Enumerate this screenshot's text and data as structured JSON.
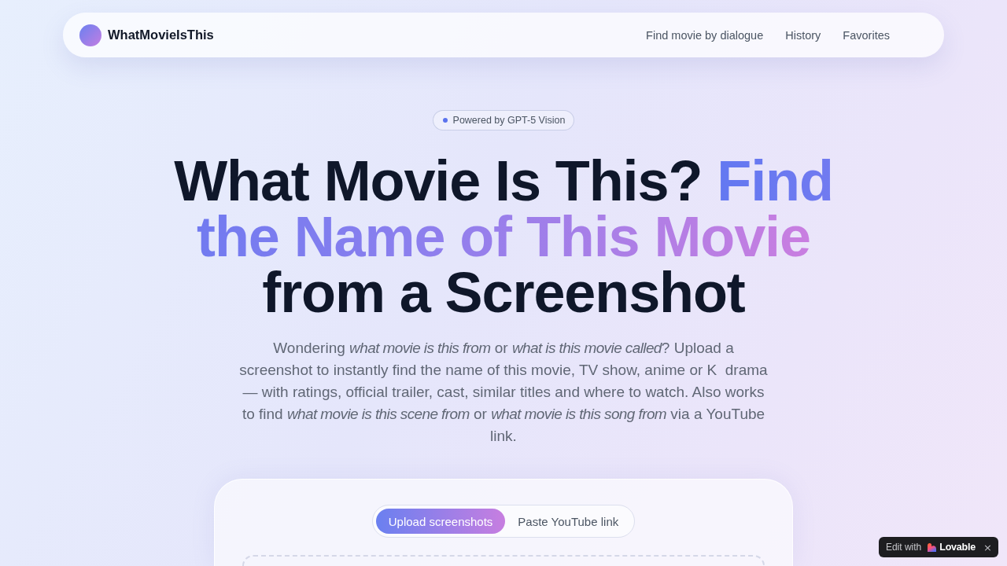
{
  "nav": {
    "logo": "WhatMovieIsThis",
    "links": [
      {
        "label": "Find movie by dialogue"
      },
      {
        "label": "History"
      },
      {
        "label": "Favorites"
      }
    ]
  },
  "hero": {
    "badge": "Powered by GPT-5 Vision",
    "title": [
      {
        "text": "What Movie Is This?",
        "kind": "plain"
      },
      {
        "text": "Find the Name of This Movie",
        "kind": "gradient"
      },
      {
        "text": "from a Screenshot",
        "kind": "plain"
      }
    ],
    "intro": "Wondering *what movie is this from* or *what is this movie called*? Upload a screenshot to instantly find the name of this movie, TV show, anime or K  drama — with ratings, official trailer, cast, similar titles and where to watch. Also works to find *what movie is this scene from* or *what movie is this song from* via a YouTube link."
  },
  "upload": {
    "tabs": [
      {
        "label": "Upload screenshots",
        "selected": true
      },
      {
        "label": "Paste YouTube link",
        "selected": false
      }
    ]
  },
  "edit_badge": {
    "label": "Edit with",
    "brand": "Lovable",
    "close": "×"
  }
}
